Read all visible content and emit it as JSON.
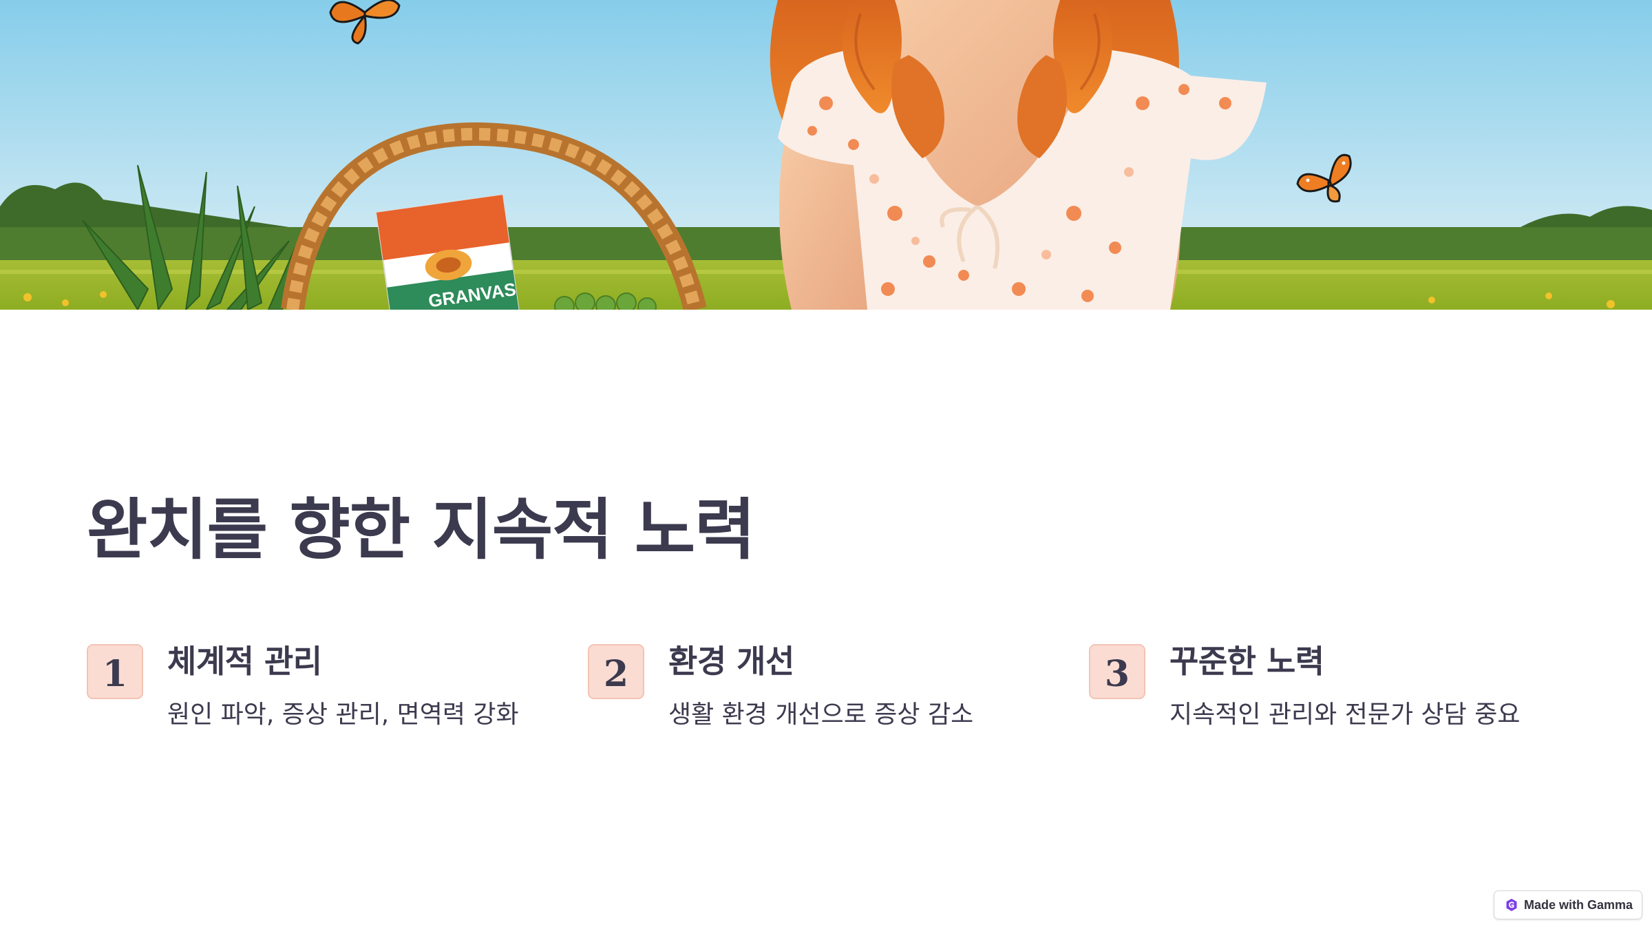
{
  "hero": {
    "image": "illustration: red-haired woman in floral dress, wicker basket with pineapple leaves, snack bag and green grapes, monarch butterflies, meadow under blue sky",
    "bag_text": "GRANVAS"
  },
  "slide": {
    "title": "완치를 향한 지속적 노력",
    "steps": [
      {
        "number": "1",
        "title": "체계적 관리",
        "description": "원인 파악, 증상 관리, 면역력 강화"
      },
      {
        "number": "2",
        "title": "환경 개선",
        "description": "생활 환경 개선으로 증상 감소"
      },
      {
        "number": "3",
        "title": "꾸준한 노력",
        "description": "지속적인 관리와 전문가 상담 중요"
      }
    ]
  },
  "badge": {
    "label": "Made with Gamma",
    "icon": "gamma-logo-icon"
  },
  "colors": {
    "text": "#3c3a4e",
    "number_box_fill": "#fbdcd3",
    "number_box_border": "#f3c3b3",
    "sky_top": "#8fd0ec",
    "grass": "#a8c23a"
  }
}
